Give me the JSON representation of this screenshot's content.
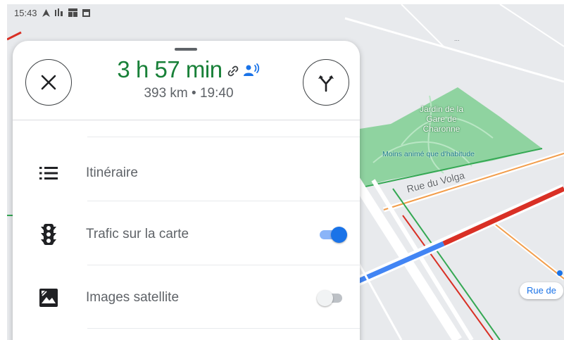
{
  "status_bar": {
    "time": "15:43"
  },
  "map": {
    "top_label": "...",
    "park_name": "Jardin de la Gare de Charonne",
    "park_note": "Moins animé que d'habitude",
    "street_volga": "Rue du Volga",
    "street_chip": "Rue de",
    "colors": {
      "park": "#8fd3a0",
      "traffic_slow": "#d93025",
      "route": "#4285f4",
      "road_orange": "#f29d4b"
    }
  },
  "sheet": {
    "eta": {
      "hours": "3",
      "h_unit": "h",
      "minutes": "57",
      "min_unit": "min"
    },
    "summary": {
      "distance": "393 km",
      "separator": "•",
      "arrival": "19:40"
    },
    "close_icon": "close-icon",
    "alternatives_icon": "fork-arrows-icon",
    "items": [
      {
        "label": "Itinéraire",
        "icon": "list-icon"
      },
      {
        "label": "Trafic sur la carte",
        "icon": "traffic-light-icon",
        "toggle": true
      },
      {
        "label": "Images satellite",
        "icon": "satellite-image-icon",
        "toggle": false
      }
    ],
    "colors": {
      "eta": "#188038",
      "toggle_on": "#1a73e8",
      "toggle_off": "#bdc1c6"
    }
  }
}
